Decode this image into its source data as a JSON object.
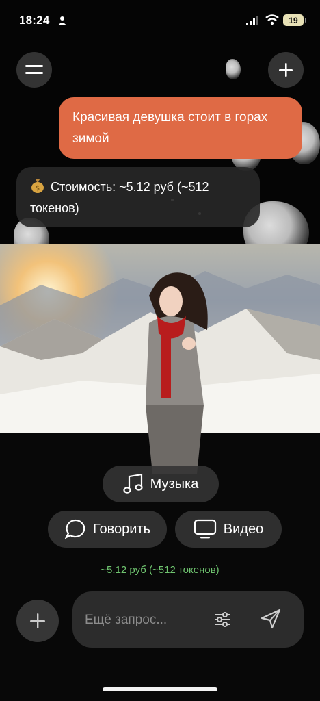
{
  "status_bar": {
    "time": "18:24",
    "battery": "19"
  },
  "chat": {
    "user_message": "Красивая девушка стоит в горах зимой",
    "cost_message": "Стоимость: ~5.12 руб (~512 токенов)"
  },
  "actions": {
    "music_label": "Музыка",
    "talk_label": "Говорить",
    "video_label": "Видео",
    "cost_note": "~5.12 руб (~512 токенов)"
  },
  "composer": {
    "placeholder": "Ещё запрос..."
  },
  "colors": {
    "accent": "#df6a45",
    "cost_note": "#6fc46f",
    "background": "#050505"
  }
}
